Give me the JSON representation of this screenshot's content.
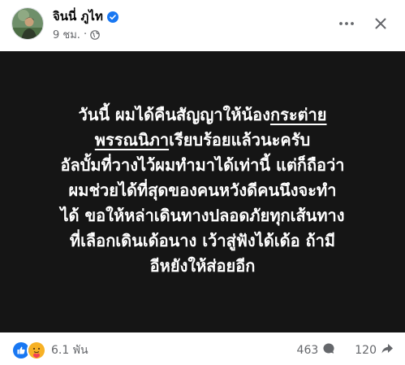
{
  "post": {
    "author_name": "จินนี่ ภูไท",
    "time": "9 ชม.",
    "separator": "·",
    "text_lines": [
      {
        "before": "วันนี้ ผมได้คืนสัญญาให้น้อง",
        "tag": "กระต่าย",
        "after": ""
      },
      {
        "before": "",
        "tag": "พรรณนิภา",
        "after": "เรียบร้อยแล้วนะครับ"
      },
      {
        "before": "อัลบั้มที่วางไว้ผมทำมาได้เท่านี้ แต่ก็ถือว่า",
        "tag": "",
        "after": ""
      },
      {
        "before": "ผมช่วยได้ที่สุดของคนหวังดีคนนึงจะทำ",
        "tag": "",
        "after": ""
      },
      {
        "before": "ได้ ขอให้หล่าเดินทางปลอดภัยทุกเส้นทาง",
        "tag": "",
        "after": ""
      },
      {
        "before": "ที่เลือกเดินเด้อนาง เว้าสู่ฟังได้เด้อ ถ้ามี",
        "tag": "",
        "after": ""
      },
      {
        "before": "อีหยังให้ส่อยอีก",
        "tag": "",
        "after": ""
      }
    ],
    "background_color": "#151515"
  },
  "footer": {
    "reaction_icons": [
      "like-icon",
      "care-icon"
    ],
    "reaction_count": "6.1 พัน",
    "comments_count": "463",
    "shares_count": "120"
  },
  "colors": {
    "verified": "#1877f2",
    "muted_text": "#65676b",
    "like": "#1877f2",
    "care": "#f7b125"
  }
}
